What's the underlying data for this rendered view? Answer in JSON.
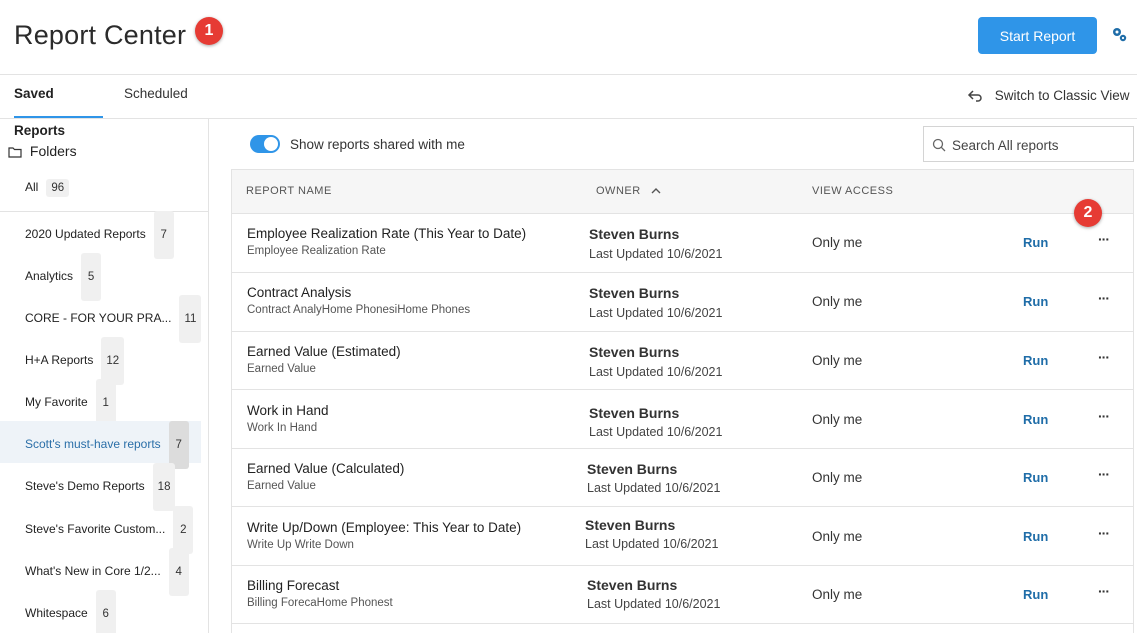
{
  "header": {
    "title": "Report Center",
    "callout_1": "1",
    "start_button": "Start Report",
    "accent_color": "#2f95e8"
  },
  "tabs": {
    "saved": "Saved Reports",
    "scheduled": "Scheduled",
    "switch_view": "Switch to Classic View"
  },
  "sidebar": {
    "folders_label": "Folders",
    "all": {
      "label": "All",
      "count": "96"
    },
    "folders": [
      {
        "label": "2020 Updated Reports",
        "count": "7"
      },
      {
        "label": "Analytics",
        "count": "5"
      },
      {
        "label": "CORE - FOR YOUR PRA...",
        "count": "11"
      },
      {
        "label": "H+A Reports",
        "count": "12"
      },
      {
        "label": "My Favorite",
        "count": "1"
      },
      {
        "label": "Scott's must-have reports",
        "count": "7"
      },
      {
        "label": "Steve's Demo Reports",
        "count": "18"
      },
      {
        "label": "Steve's Favorite Custom...",
        "count": "2"
      },
      {
        "label": "What's New in Core 1/2...",
        "count": "4"
      },
      {
        "label": "Whitespace",
        "count": "6"
      }
    ]
  },
  "main": {
    "toggle_label": "Show reports shared with me",
    "search_placeholder": "Search All reports",
    "callout_2": "2",
    "columns": {
      "name": "REPORT NAME",
      "owner": "OWNER",
      "access": "VIEW ACCESS"
    },
    "run_label": "Run",
    "more_label": "···",
    "rows": [
      {
        "name": "Employee Realization Rate (This Year to Date)",
        "sub": "Employee Realization Rate",
        "owner": "Steven Burns",
        "updated": "Last Updated 10/6/2021",
        "access": "Only me"
      },
      {
        "name": "Contract Analysis",
        "sub": "Contract AnalyHome PhonesiHome Phones",
        "owner": "Steven Burns",
        "updated": "Last Updated 10/6/2021",
        "access": "Only me"
      },
      {
        "name": "Earned Value (Estimated)",
        "sub": "Earned Value",
        "owner": "Steven Burns",
        "updated": "Last Updated 10/6/2021",
        "access": "Only me"
      },
      {
        "name": "Work in Hand",
        "sub": "Work In Hand",
        "owner": "Steven Burns",
        "updated": "Last Updated 10/6/2021",
        "access": "Only me"
      },
      {
        "name": "Earned Value (Calculated)",
        "sub": "Earned Value",
        "owner": "Steven Burns",
        "updated": "Last Updated 10/6/2021",
        "access": "Only me"
      },
      {
        "name": "Write Up/Down (Employee: This Year to Date)",
        "sub": "Write Up Write Down",
        "owner": "Steven Burns",
        "updated": "Last Updated 10/6/2021",
        "access": "Only me"
      },
      {
        "name": "Billing Forecast",
        "sub": "Billing ForecaHome Phonest",
        "owner": "Steven Burns",
        "updated": "Last Updated 10/6/2021",
        "access": "Only me"
      }
    ]
  }
}
